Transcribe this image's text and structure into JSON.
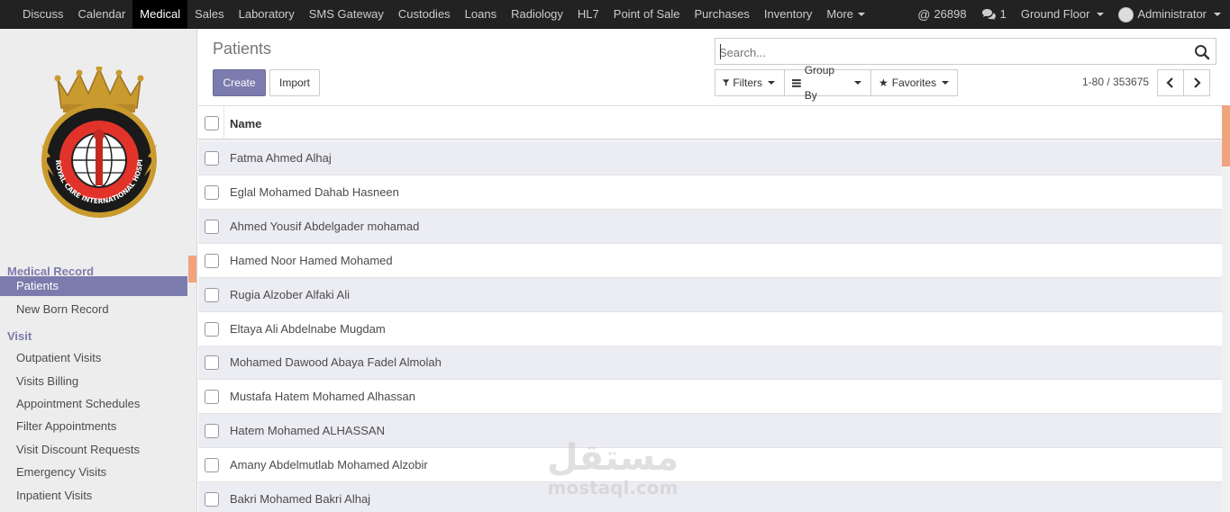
{
  "topbar": {
    "menu": [
      {
        "label": "Discuss",
        "active": false
      },
      {
        "label": "Calendar",
        "active": false
      },
      {
        "label": "Medical",
        "active": true
      },
      {
        "label": "Sales",
        "active": false
      },
      {
        "label": "Laboratory",
        "active": false
      },
      {
        "label": "SMS Gateway",
        "active": false
      },
      {
        "label": "Custodies",
        "active": false
      },
      {
        "label": "Loans",
        "active": false
      },
      {
        "label": "Radiology",
        "active": false
      },
      {
        "label": "HL7",
        "active": false
      },
      {
        "label": "Point of Sale",
        "active": false
      },
      {
        "label": "Purchases",
        "active": false
      },
      {
        "label": "Inventory",
        "active": false
      },
      {
        "label": "More",
        "active": false
      }
    ],
    "mentions_count": "26898",
    "messages_count": "1",
    "location": "Ground Floor",
    "user": "Administrator"
  },
  "sidebar": {
    "logo_text": "ROYAL CARE INTERNATIONAL HOSPITAL",
    "sections": [
      {
        "title": "Medical Record",
        "items": [
          {
            "label": "Patients",
            "active": true
          },
          {
            "label": "New Born Record",
            "active": false
          }
        ]
      },
      {
        "title": "Visit",
        "items": [
          {
            "label": "Outpatient Visits",
            "active": false
          },
          {
            "label": "Visits Billing",
            "active": false
          },
          {
            "label": "Appointment Schedules",
            "active": false
          },
          {
            "label": "Filter Appointments",
            "active": false
          },
          {
            "label": "Visit Discount Requests",
            "active": false
          },
          {
            "label": "Emergency Visits",
            "active": false
          },
          {
            "label": "Inpatient Visits",
            "active": false
          }
        ]
      }
    ]
  },
  "control_panel": {
    "breadcrumb": "Patients",
    "create_label": "Create",
    "import_label": "Import",
    "search_placeholder": "Search...",
    "filters_label": "Filters",
    "groupby_label": "Group By",
    "favorites_label": "Favorites",
    "pager_text": "1-80 / 353675"
  },
  "list": {
    "column_name": "Name",
    "rows": [
      "Fatma Ahmed Alhaj",
      "Eglal Mohamed Dahab Hasneen",
      "Ahmed Yousif Abdelgader mohamad",
      "Hamed Noor Hamed Mohamed",
      "Rugia Alzober Alfaki Ali",
      "Eltaya Ali Abdelnabe Mugdam",
      "Mohamed Dawood Abaya Fadel Almolah",
      "Mustafa Hatem Mohamed Alhassan",
      "Hatem Mohamed ALHASSAN",
      "Amany Abdelmutlab Mohamed Alzobir",
      "Bakri Mohamed Bakri Alhaj"
    ]
  },
  "watermark": {
    "arabic": "مستقل",
    "latin": "mostaql.com"
  },
  "colors": {
    "accent": "#7c7bad",
    "navbar": "#222222",
    "scroll_thumb": "#f0a47e",
    "odd_row": "#ececf3"
  }
}
